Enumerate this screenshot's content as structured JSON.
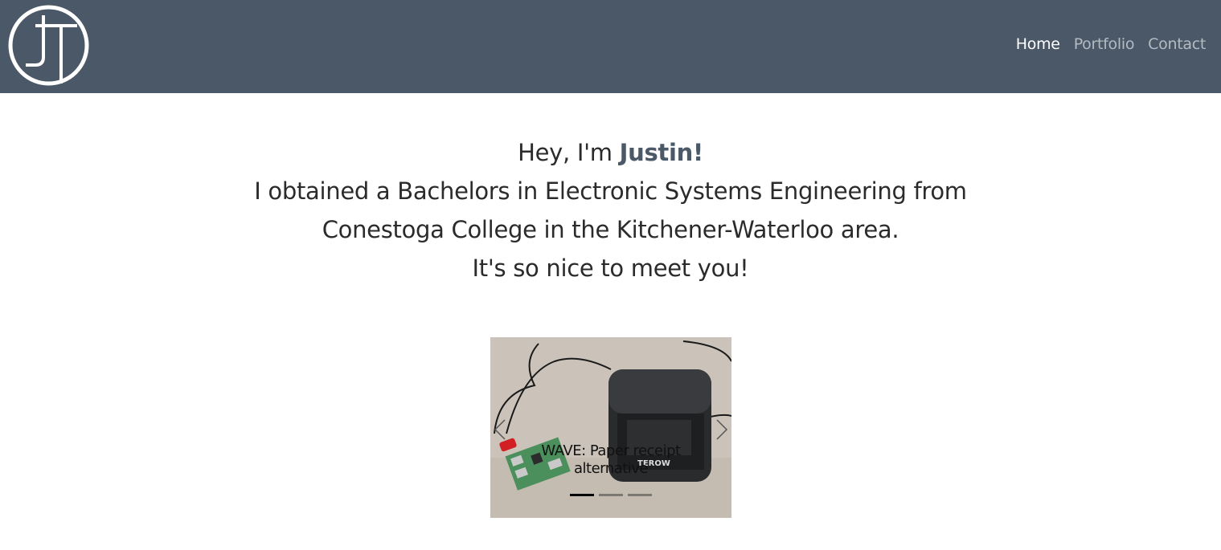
{
  "brand": {
    "logo_letters": "JT",
    "logo_color": "#ffffff"
  },
  "colors": {
    "nav_bg": "#4a5867",
    "accent": "#4a5867"
  },
  "nav": {
    "items": [
      {
        "label": "Home",
        "active": true
      },
      {
        "label": "Portfolio",
        "active": false
      },
      {
        "label": "Contact",
        "active": false
      }
    ]
  },
  "hero": {
    "greeting_prefix": "Hey, I'm ",
    "name": "Justin!",
    "line2": "I obtained a Bachelors in Electronic Systems Engineering from",
    "line3": "Conestoga College in the Kitchener-Waterloo area.",
    "line4": "It's so nice to meet you!"
  },
  "carousel": {
    "active_index": 0,
    "slides": [
      {
        "caption": "WAVE: Paper receipt alternative",
        "printer_label": "TEROW"
      }
    ],
    "indicator_count": 3,
    "prev_icon": "chevron-left-icon",
    "next_icon": "chevron-right-icon"
  }
}
